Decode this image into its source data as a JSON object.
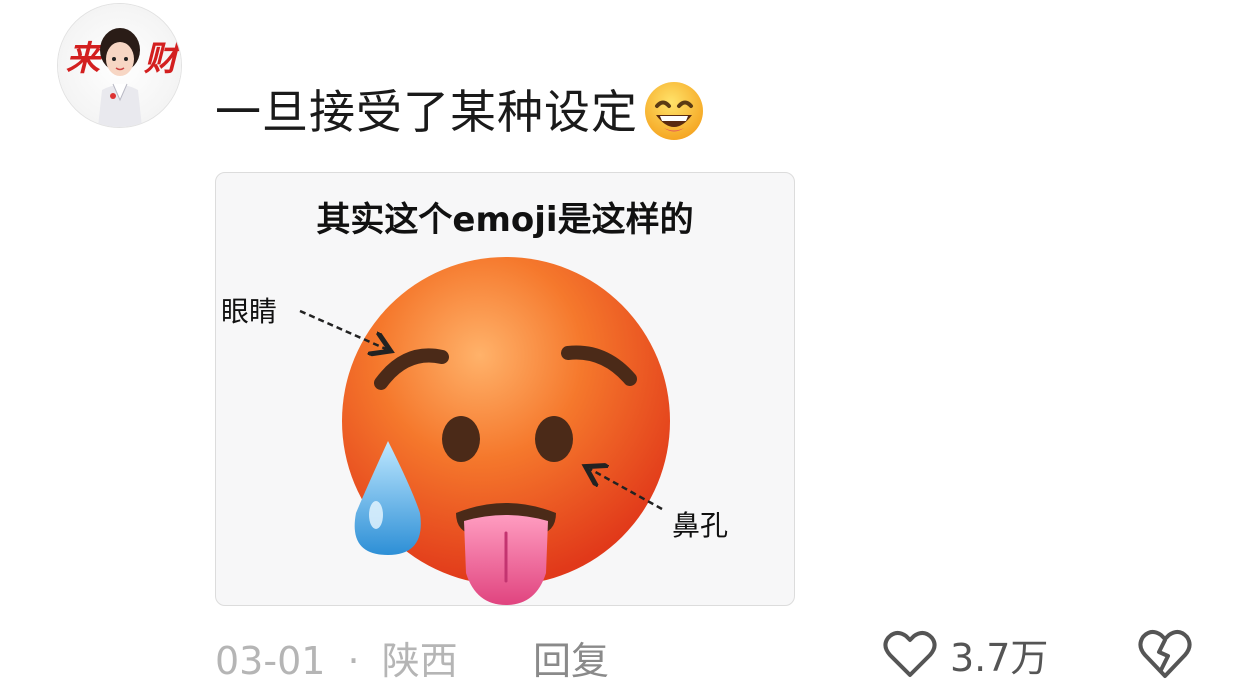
{
  "comment": {
    "avatar_text": "来财",
    "text": "一旦接受了某种设定",
    "emoji_icon": "grinning-sweat-face-icon"
  },
  "image": {
    "title": "其实这个emoji是这样的",
    "label_eyes": "眼睛",
    "label_nostrils": "鼻孔",
    "emoji_icon": "hot-face-icon"
  },
  "meta": {
    "date": "03-01",
    "separator": "·",
    "location": "陕西",
    "reply_label": "回复",
    "like_count": "3.7万"
  },
  "colors": {
    "text_dark": "#1a1a1a",
    "meta_gray": "#b5b5b5",
    "face_orange": "#f26a1f",
    "tongue_pink": "#f06a9a",
    "drop_blue": "#5fb6ec"
  }
}
